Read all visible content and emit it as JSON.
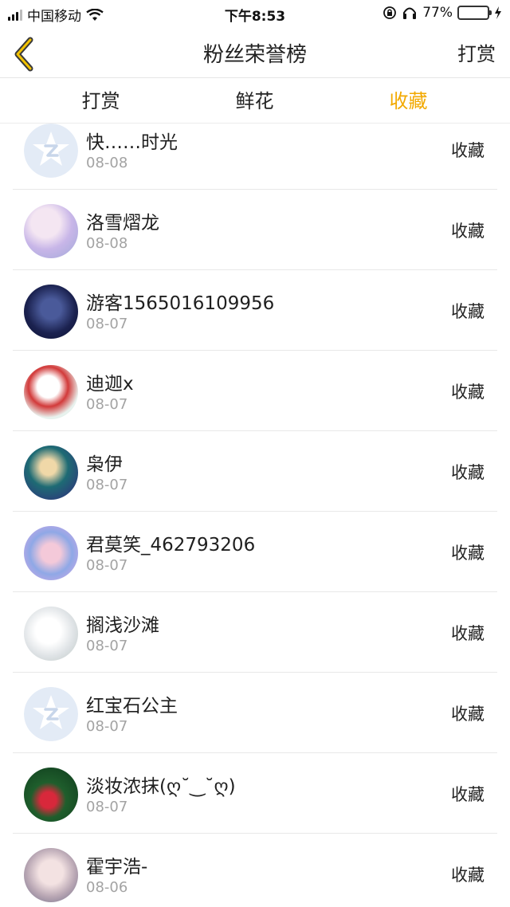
{
  "status_bar": {
    "carrier": "中国移动",
    "time": "下午8:53",
    "battery": "77%",
    "battery_level": 0.77,
    "icons": [
      "signal-icon",
      "wifi-icon",
      "orientation-lock-icon",
      "headphones-icon",
      "battery-icon",
      "charging-icon"
    ]
  },
  "header": {
    "title": "粉丝荣誉榜",
    "back_icon": "chevron-left-icon",
    "right_label": "打赏",
    "accent": "#f2a900"
  },
  "tabs": [
    {
      "label": "打赏",
      "active": false
    },
    {
      "label": "鲜花",
      "active": false
    },
    {
      "label": "收藏",
      "active": true
    }
  ],
  "list": [
    {
      "name": "快……时光",
      "date": "08-08",
      "action": "收藏",
      "avatar": "default-avatar-icon"
    },
    {
      "name": "洛雪熠龙",
      "date": "08-08",
      "action": "收藏",
      "avatar": "user-avatar"
    },
    {
      "name": "游客1565016109956",
      "date": "08-07",
      "action": "收藏",
      "avatar": "user-avatar"
    },
    {
      "name": "迪迦x",
      "date": "08-07",
      "action": "收藏",
      "avatar": "user-avatar"
    },
    {
      "name": "枭伊",
      "date": "08-07",
      "action": "收藏",
      "avatar": "user-avatar"
    },
    {
      "name": "君莫笑_462793206",
      "date": "08-07",
      "action": "收藏",
      "avatar": "user-avatar"
    },
    {
      "name": "搁浅沙滩",
      "date": "08-07",
      "action": "收藏",
      "avatar": "user-avatar"
    },
    {
      "name": "红宝石公主",
      "date": "08-07",
      "action": "收藏",
      "avatar": "default-avatar-icon"
    },
    {
      "name": "淡妆浓抹(ღ˘‿˘ღ)",
      "date": "08-07",
      "action": "收藏",
      "avatar": "user-avatar"
    },
    {
      "name": "霍宇浩-",
      "date": "08-06",
      "action": "收藏",
      "avatar": "user-avatar"
    }
  ]
}
